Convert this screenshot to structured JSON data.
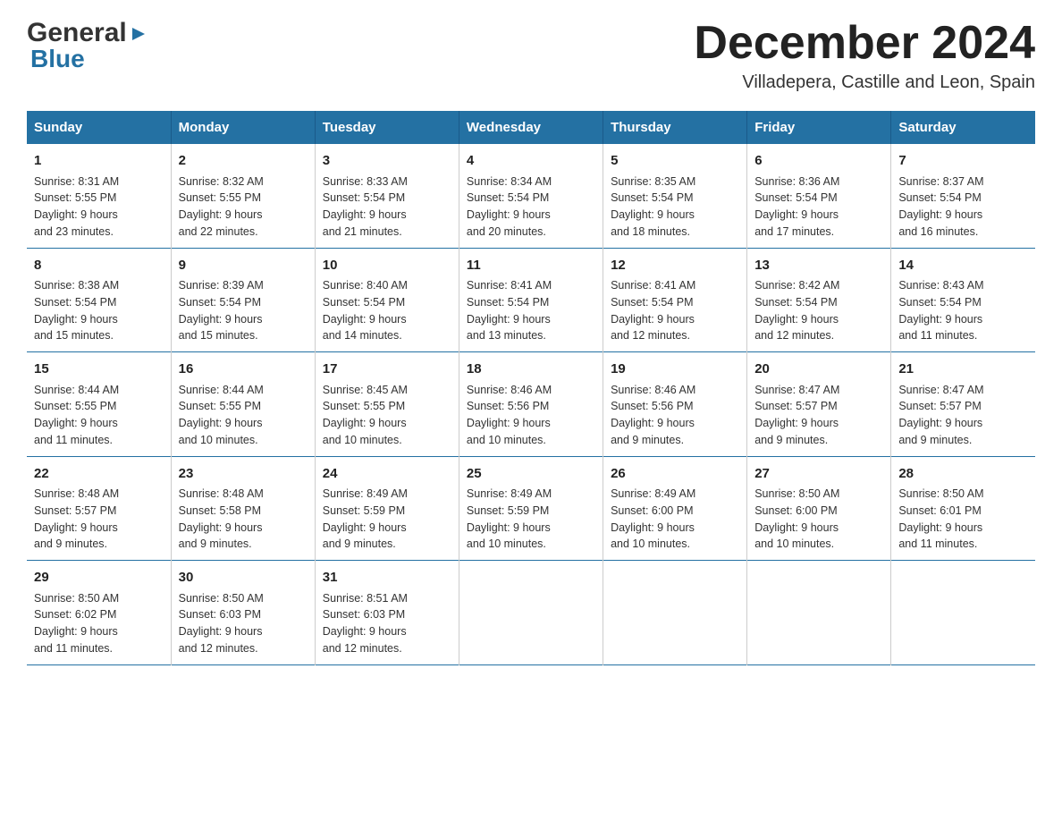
{
  "header": {
    "title": "December 2024",
    "subtitle": "Villadepera, Castille and Leon, Spain"
  },
  "logo": {
    "general": "General",
    "blue": "Blue"
  },
  "days": [
    "Sunday",
    "Monday",
    "Tuesday",
    "Wednesday",
    "Thursday",
    "Friday",
    "Saturday"
  ],
  "weeks": [
    [
      {
        "num": "1",
        "sunrise": "8:31 AM",
        "sunset": "5:55 PM",
        "daylight": "9 hours and 23 minutes."
      },
      {
        "num": "2",
        "sunrise": "8:32 AM",
        "sunset": "5:55 PM",
        "daylight": "9 hours and 22 minutes."
      },
      {
        "num": "3",
        "sunrise": "8:33 AM",
        "sunset": "5:54 PM",
        "daylight": "9 hours and 21 minutes."
      },
      {
        "num": "4",
        "sunrise": "8:34 AM",
        "sunset": "5:54 PM",
        "daylight": "9 hours and 20 minutes."
      },
      {
        "num": "5",
        "sunrise": "8:35 AM",
        "sunset": "5:54 PM",
        "daylight": "9 hours and 18 minutes."
      },
      {
        "num": "6",
        "sunrise": "8:36 AM",
        "sunset": "5:54 PM",
        "daylight": "9 hours and 17 minutes."
      },
      {
        "num": "7",
        "sunrise": "8:37 AM",
        "sunset": "5:54 PM",
        "daylight": "9 hours and 16 minutes."
      }
    ],
    [
      {
        "num": "8",
        "sunrise": "8:38 AM",
        "sunset": "5:54 PM",
        "daylight": "9 hours and 15 minutes."
      },
      {
        "num": "9",
        "sunrise": "8:39 AM",
        "sunset": "5:54 PM",
        "daylight": "9 hours and 15 minutes."
      },
      {
        "num": "10",
        "sunrise": "8:40 AM",
        "sunset": "5:54 PM",
        "daylight": "9 hours and 14 minutes."
      },
      {
        "num": "11",
        "sunrise": "8:41 AM",
        "sunset": "5:54 PM",
        "daylight": "9 hours and 13 minutes."
      },
      {
        "num": "12",
        "sunrise": "8:41 AM",
        "sunset": "5:54 PM",
        "daylight": "9 hours and 12 minutes."
      },
      {
        "num": "13",
        "sunrise": "8:42 AM",
        "sunset": "5:54 PM",
        "daylight": "9 hours and 12 minutes."
      },
      {
        "num": "14",
        "sunrise": "8:43 AM",
        "sunset": "5:54 PM",
        "daylight": "9 hours and 11 minutes."
      }
    ],
    [
      {
        "num": "15",
        "sunrise": "8:44 AM",
        "sunset": "5:55 PM",
        "daylight": "9 hours and 11 minutes."
      },
      {
        "num": "16",
        "sunrise": "8:44 AM",
        "sunset": "5:55 PM",
        "daylight": "9 hours and 10 minutes."
      },
      {
        "num": "17",
        "sunrise": "8:45 AM",
        "sunset": "5:55 PM",
        "daylight": "9 hours and 10 minutes."
      },
      {
        "num": "18",
        "sunrise": "8:46 AM",
        "sunset": "5:56 PM",
        "daylight": "9 hours and 10 minutes."
      },
      {
        "num": "19",
        "sunrise": "8:46 AM",
        "sunset": "5:56 PM",
        "daylight": "9 hours and 9 minutes."
      },
      {
        "num": "20",
        "sunrise": "8:47 AM",
        "sunset": "5:57 PM",
        "daylight": "9 hours and 9 minutes."
      },
      {
        "num": "21",
        "sunrise": "8:47 AM",
        "sunset": "5:57 PM",
        "daylight": "9 hours and 9 minutes."
      }
    ],
    [
      {
        "num": "22",
        "sunrise": "8:48 AM",
        "sunset": "5:57 PM",
        "daylight": "9 hours and 9 minutes."
      },
      {
        "num": "23",
        "sunrise": "8:48 AM",
        "sunset": "5:58 PM",
        "daylight": "9 hours and 9 minutes."
      },
      {
        "num": "24",
        "sunrise": "8:49 AM",
        "sunset": "5:59 PM",
        "daylight": "9 hours and 9 minutes."
      },
      {
        "num": "25",
        "sunrise": "8:49 AM",
        "sunset": "5:59 PM",
        "daylight": "9 hours and 10 minutes."
      },
      {
        "num": "26",
        "sunrise": "8:49 AM",
        "sunset": "6:00 PM",
        "daylight": "9 hours and 10 minutes."
      },
      {
        "num": "27",
        "sunrise": "8:50 AM",
        "sunset": "6:00 PM",
        "daylight": "9 hours and 10 minutes."
      },
      {
        "num": "28",
        "sunrise": "8:50 AM",
        "sunset": "6:01 PM",
        "daylight": "9 hours and 11 minutes."
      }
    ],
    [
      {
        "num": "29",
        "sunrise": "8:50 AM",
        "sunset": "6:02 PM",
        "daylight": "9 hours and 11 minutes."
      },
      {
        "num": "30",
        "sunrise": "8:50 AM",
        "sunset": "6:03 PM",
        "daylight": "9 hours and 12 minutes."
      },
      {
        "num": "31",
        "sunrise": "8:51 AM",
        "sunset": "6:03 PM",
        "daylight": "9 hours and 12 minutes."
      },
      null,
      null,
      null,
      null
    ]
  ],
  "cell_labels": {
    "sunrise": "Sunrise:",
    "sunset": "Sunset:",
    "daylight": "Daylight:"
  }
}
